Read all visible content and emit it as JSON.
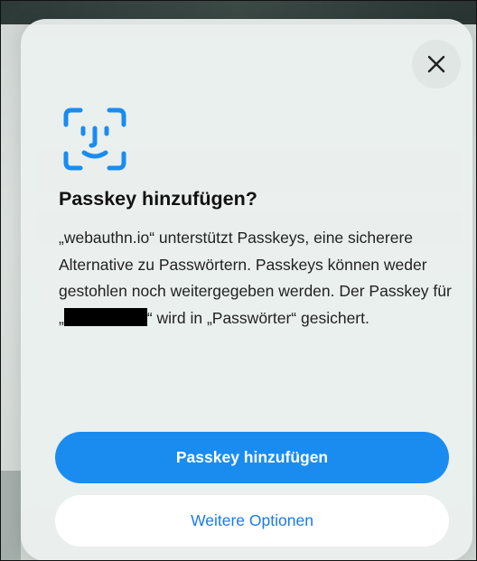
{
  "dialog": {
    "close_icon": "close-icon",
    "face_icon": "face-id-icon",
    "title": "Passkey hinzufügen?",
    "body_before_redaction": "„webauthn.io“ unterstützt Passkeys, eine sicherere Alternative zu Passwörtern. Passkeys können weder gestohlen noch weitergegeben werden. Der Passkey für „",
    "body_after_redaction": "“ wird in „Passwörter“ gesichert.",
    "primary_button": "Passkey hinzufügen",
    "secondary_button": "Weitere Optionen"
  },
  "colors": {
    "accent": "#1a8cf0",
    "secondary_text": "#1a7ae6",
    "face_icon": "#1a8cf0",
    "sheet": "#ecf1ef"
  }
}
